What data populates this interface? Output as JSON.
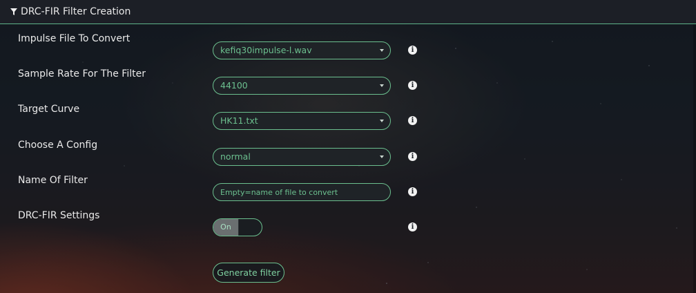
{
  "header": {
    "title": "DRC-FIR Filter Creation",
    "icon": "funnel-icon"
  },
  "form": {
    "impulse": {
      "label": "Impulse File To Convert",
      "value": "kefiq30impulse-l.wav"
    },
    "samplerate": {
      "label": "Sample Rate For The Filter",
      "value": "44100"
    },
    "curve": {
      "label": "Target Curve",
      "value": "HK11.txt"
    },
    "config": {
      "label": "Choose A Config",
      "value": "normal"
    },
    "name": {
      "label": "Name Of Filter",
      "value": "",
      "placeholder": "Empty=name of file to convert"
    },
    "settings": {
      "label": "DRC-FIR Settings",
      "toggle_label": "On"
    },
    "generate_label": "Generate filter"
  },
  "colors": {
    "accent": "#6cc08f",
    "field_bg": "#1f2327",
    "info_icon": "#f2f2f2"
  }
}
